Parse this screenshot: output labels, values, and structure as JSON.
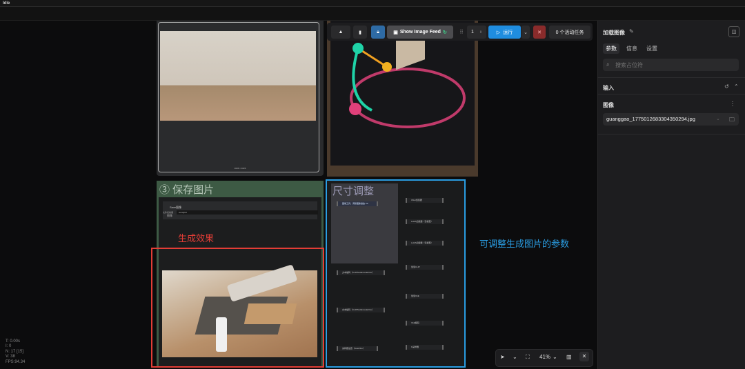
{
  "window": {
    "title": "Idle"
  },
  "nodes": {
    "save_image": {
      "title": "③ 保存图片",
      "sub_title": "Save图像",
      "sub_row": "图像",
      "field_label": "文件名前缀",
      "field_value": "ComfyUI"
    },
    "resize": {
      "title": "尺寸调整",
      "header_item": "图像工具：调整图像缩放 V2",
      "left_items": [
        "文本编码（CLIPTextEncodeFlux）",
        "文本编码（CLIPTextEncodeFlux）",
        "采样器设置（AutoFlux）"
      ],
      "right_items": [
        "UNet加载器",
        "LoRA加载器（仅模型）",
        "LoRA加载器（仅模型）",
        "加载CLIP",
        "加载VAE",
        "VAE解码",
        "K采样器"
      ]
    },
    "preview_caption": "1024 × 1024"
  },
  "annotations": {
    "generated_effect": "生成效果",
    "adjustable_params": "可调整生成图片的参数"
  },
  "toolbar": {
    "show_image_feed": "Show Image Feed",
    "batch_count": "1",
    "run_label": "运行",
    "active_tasks": "0 个活动任务"
  },
  "sidebar": {
    "title": "加载图像",
    "tabs": [
      "参数",
      "信息",
      "设置"
    ],
    "search_placeholder": "搜索占位符",
    "section_input": "输入",
    "field_label": "图像",
    "file_value": "guanggao_1775012683304350294.jpg"
  },
  "bottom_tools": {
    "zoom": "41%"
  },
  "stats": [
    "T: 0.00s",
    "I: 0",
    "N: 17 [15]",
    "V: 38",
    "FPS:94.34"
  ],
  "colors": {
    "accent_blue": "#1f8de0",
    "annotation_red": "#e33d36",
    "annotation_blue": "#2a9de2",
    "save_node_green": "#3d5a44"
  }
}
